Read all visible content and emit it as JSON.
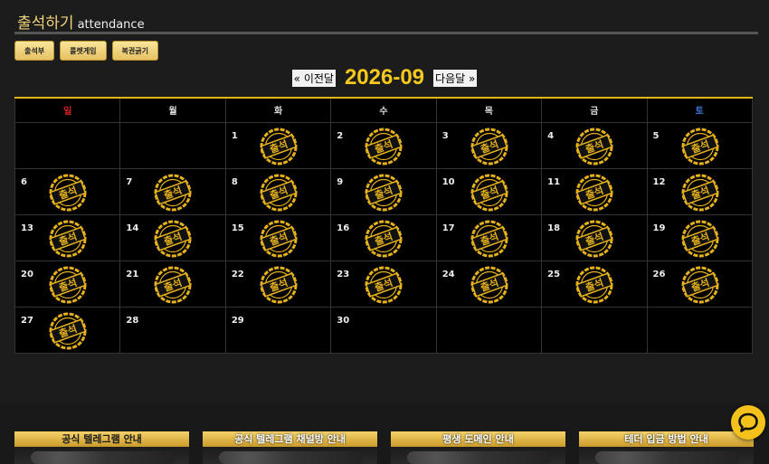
{
  "header": {
    "title": "출석하기",
    "subtitle": "attendance"
  },
  "tabs": [
    {
      "label": "출석부"
    },
    {
      "label": "룰렛게임"
    },
    {
      "label": "복권긁기"
    }
  ],
  "nav": {
    "prev_label": "« 이전달",
    "month": "2026-09",
    "next_label": "다음달 »"
  },
  "weekdays": [
    "일",
    "월",
    "화",
    "수",
    "목",
    "금",
    "토"
  ],
  "calendar": {
    "weeks": [
      [
        {
          "day": ""
        },
        {
          "day": ""
        },
        {
          "day": "1",
          "stamp": true
        },
        {
          "day": "2",
          "stamp": true
        },
        {
          "day": "3",
          "stamp": true
        },
        {
          "day": "4",
          "stamp": true
        },
        {
          "day": "5",
          "stamp": true
        }
      ],
      [
        {
          "day": "6",
          "stamp": true
        },
        {
          "day": "7",
          "stamp": true
        },
        {
          "day": "8",
          "stamp": true
        },
        {
          "day": "9",
          "stamp": true
        },
        {
          "day": "10",
          "stamp": true
        },
        {
          "day": "11",
          "stamp": true
        },
        {
          "day": "12",
          "stamp": true
        }
      ],
      [
        {
          "day": "13",
          "stamp": true
        },
        {
          "day": "14",
          "stamp": true
        },
        {
          "day": "15",
          "stamp": true
        },
        {
          "day": "16",
          "stamp": true
        },
        {
          "day": "17",
          "stamp": true
        },
        {
          "day": "18",
          "stamp": true
        },
        {
          "day": "19",
          "stamp": true
        }
      ],
      [
        {
          "day": "20",
          "stamp": true
        },
        {
          "day": "21",
          "stamp": true
        },
        {
          "day": "22",
          "stamp": true
        },
        {
          "day": "23",
          "stamp": true
        },
        {
          "day": "24",
          "stamp": true
        },
        {
          "day": "25",
          "stamp": true
        },
        {
          "day": "26",
          "stamp": true
        }
      ],
      [
        {
          "day": "27",
          "stamp": true
        },
        {
          "day": "28"
        },
        {
          "day": "29"
        },
        {
          "day": "30"
        },
        {
          "day": ""
        },
        {
          "day": ""
        },
        {
          "day": ""
        }
      ]
    ]
  },
  "stamp_label": "출석",
  "banners": [
    {
      "label": "공식 텔레그램 안내"
    },
    {
      "label": "공식 텔레그램 채널방 안내"
    },
    {
      "label": "평생 도메인 안내"
    },
    {
      "label": "테더 입금 방법 안내"
    }
  ],
  "colors": {
    "accent": "#f5c81e",
    "sunday": "#d62020",
    "saturday": "#3a7bd5",
    "stamp_gold": "#e6b21c"
  },
  "icons": {
    "chat": "chat-bubble-icon",
    "stamp": "attendance-stamp-icon"
  }
}
